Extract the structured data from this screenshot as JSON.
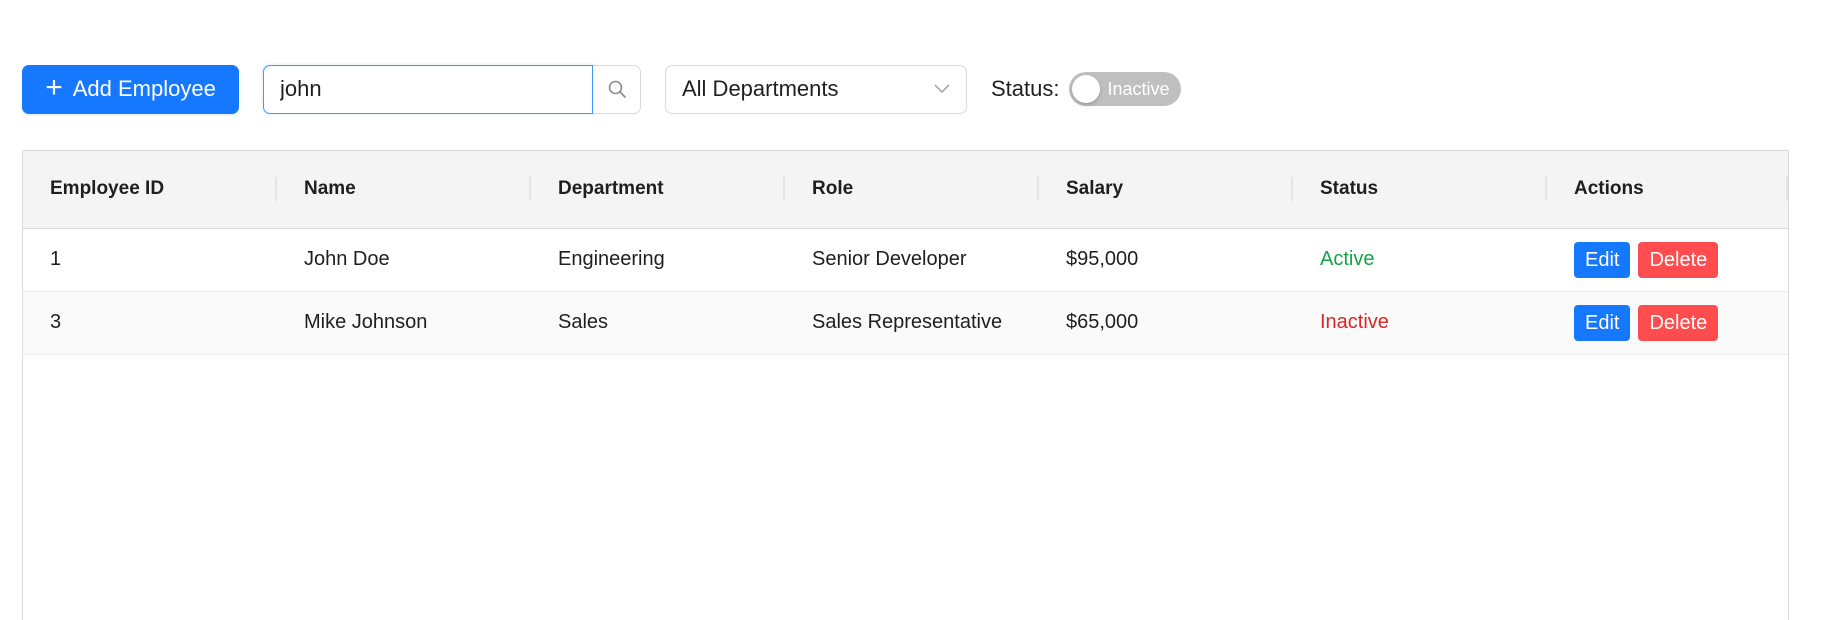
{
  "toolbar": {
    "add_label": "Add Employee",
    "search_value": "john",
    "department_selected": "All Departments",
    "status_label": "Status:",
    "status_toggle_text": "Inactive"
  },
  "colors": {
    "primary": "#1677ff",
    "danger": "#ff4d4f",
    "active": "#16a34a",
    "inactive": "#dc2626"
  },
  "table": {
    "columns": [
      "Employee ID",
      "Name",
      "Department",
      "Role",
      "Salary",
      "Status",
      "Actions"
    ],
    "rows": [
      {
        "id": "1",
        "name": "John Doe",
        "department": "Engineering",
        "role": "Senior Developer",
        "salary": "$95,000",
        "status": "Active",
        "edit": "Edit",
        "delete": "Delete"
      },
      {
        "id": "3",
        "name": "Mike Johnson",
        "department": "Sales",
        "role": "Sales Representative",
        "salary": "$65,000",
        "status": "Inactive",
        "edit": "Edit",
        "delete": "Delete"
      }
    ]
  }
}
